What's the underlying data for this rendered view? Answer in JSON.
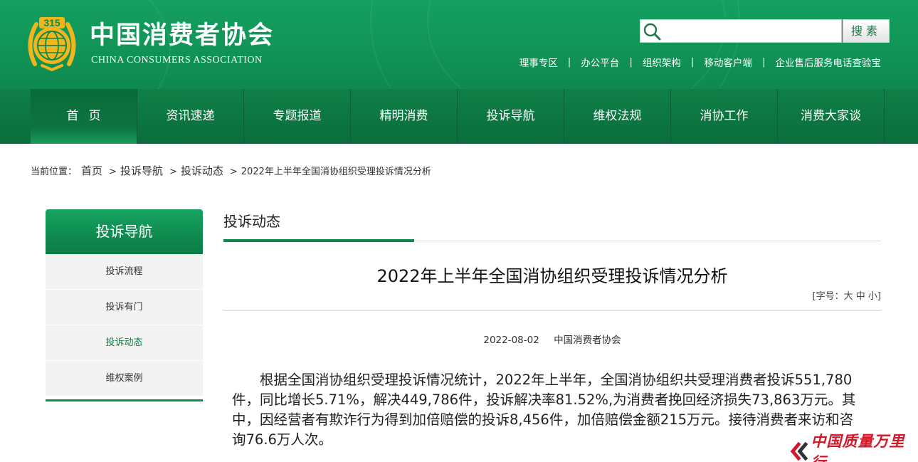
{
  "header": {
    "site_name": "中国消费者协会",
    "site_name_en": "CHINA CONSUMERS ASSOCIATION",
    "logo_number": "315",
    "search": {
      "placeholder": "",
      "value": "",
      "button_label": "搜素"
    },
    "top_links": [
      "理事专区",
      "办公平台",
      "组织架构",
      "移动客户端",
      "企业售后服务电话查验宝"
    ],
    "separator": "|"
  },
  "nav": {
    "items": [
      "首页",
      "资讯速递",
      "专题报道",
      "精明消费",
      "投诉导航",
      "维权法规",
      "消协工作",
      "消费大家谈"
    ],
    "active_index": 0
  },
  "breadcrumb": {
    "label": "当前位置：",
    "items": [
      "首页",
      "投诉导航",
      "投诉动态",
      "2022年上半年全国消协组织受理投诉情况分析"
    ],
    "arrow": ">"
  },
  "sidebar": {
    "title": "投诉导航",
    "items": [
      "投诉流程",
      "投诉有门",
      "投诉动态",
      "维权案例"
    ],
    "active_index": 2
  },
  "main": {
    "section_title": "投诉动态",
    "article_title": "2022年上半年全国消协组织受理投诉情况分析",
    "font_size": {
      "open": "[字号：",
      "large": "大",
      "medium": "中",
      "small": "小",
      "close": "]"
    },
    "date": "2022-08-02",
    "source": "中国消费者协会",
    "body": "根据全国消协组织受理投诉情况统计，2022年上半年，全国消协组织共受理消费者投诉551,780件，同比增长5.71%，解决449,786件，投诉解决率81.52%,为消费者挽回经济损失73,863万元。其中，因经营者有欺诈行为得到加倍赔偿的投诉8,456件，加倍赔偿金额215万元。接待消费者来访和咨询76.6万人次。"
  },
  "watermark": {
    "text": "中国质量万里行"
  },
  "colors": {
    "brand_green": "#0e8a4f",
    "nav_green": "#0a6e3c",
    "logo_gold": "#f2b51b",
    "watermark_red": "#d2192a"
  }
}
